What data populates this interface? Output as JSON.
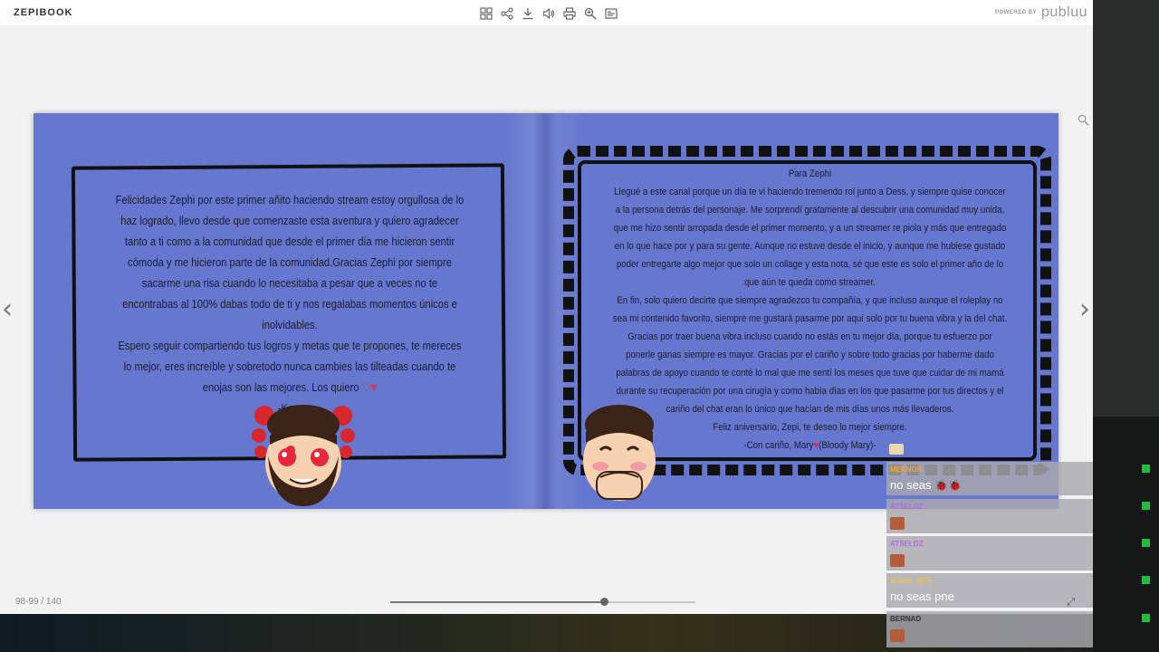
{
  "app": {
    "brand": "ZEPIBOOK",
    "powered_by": "POWERED BY",
    "powered_logo": "publuu"
  },
  "toolbar": {
    "icons": [
      "grid-icon",
      "share-icon",
      "download-icon",
      "sound-icon",
      "print-icon",
      "zoom-icon",
      "fullscreen-icon"
    ]
  },
  "page_indicator": "98-99 / 140",
  "progress": {
    "fraction": 0.7
  },
  "left_page": {
    "paragraph1": "Felicidades Zephi por este primer añito haciendo stream estoy orgullosa de lo haz logrado, llevo desde que comenzaste esta aventura y quiero agradecer tanto a ti como a la comunidad que desde el primer día me hicieron sentir cómoda y me hicieron parte de la comunidad.Gracias Zephi por siempre sacarme una risa cuando lo necesitaba a pesar que a veces no te encontrabas al 100% dabas todo de ti y nos regalabas momentos únicos e inolvidables.",
    "paragraph2": "Espero seguir compartiendo tus logros y metas que te propones, te mereces lo mejor, eres increíble y sobretodo nunca cambies las tilteadas cuando te enojas son las mejores. Los quiero",
    "signature": "-Key-"
  },
  "right_page": {
    "heading": "Para Zephi",
    "paragraph1": "Llegué a este canal porque un día te vi haciendo tremendo rol junto a Dess, y siempre quise conocer a la persona detrás del personaje. Me sorprendí gratamente al descubrir una comunidad muy unida, que me hizo sentir arropada desde el primer momento, y a un streamer re piola y más que entregado en lo que hace por y para su gente. Aunque no estuve desde el inicio, y aunque me hubiese gustado poder entregarte algo mejor que solo un collage y esta nota, sé que este es solo el primer año de lo que aún te queda como streamer.",
    "paragraph2": "En fin, solo quiero decirte que siempre agradezco tu compañía, y que incluso aunque el roleplay no sea mi contenido favorito, siempre me gustará pasarme por aquí solo por tu buena vibra y la del chat. Gracias por traer buena vibra incluso cuando no estás en tu mejor día, porque tu esfuerzo por ponerle ganas siempre es mayor. Gracias por el cariño y sobre todo gracias por haberme dado palabras de apoyo cuando te conté lo mal que me sentí los meses que tuve que cuidar de mi mamá durante su recuperación por una cirugía y como había días en los que pasarme por tus directos y el cariño del chat eran lo único que hacían de mis días unos más llevaderos.",
    "closing": "Feliz aniversario, Zepi, te deseo lo mejor siempre.",
    "signature_pre": "-Con cariño, Mary",
    "signature_post": "(Bloody Mary)-"
  },
  "chat": [
    {
      "name": "MEKNOR",
      "name_color": "#f5a623",
      "text": "no seas",
      "emotes": 2
    },
    {
      "name": "ATSELGZ",
      "name_color": "#b36be0",
      "text": "",
      "emotes": 1
    },
    {
      "name": "ATSELGZ",
      "name_color": "#b36be0",
      "text": "",
      "emotes": 1
    },
    {
      "name": "ANAHI_MT2",
      "name_color": "#f0c040",
      "text": "no seas pne",
      "emotes": 0
    },
    {
      "name": "BERNAD",
      "name_color": "#333333",
      "text": "",
      "emotes": 1
    }
  ]
}
